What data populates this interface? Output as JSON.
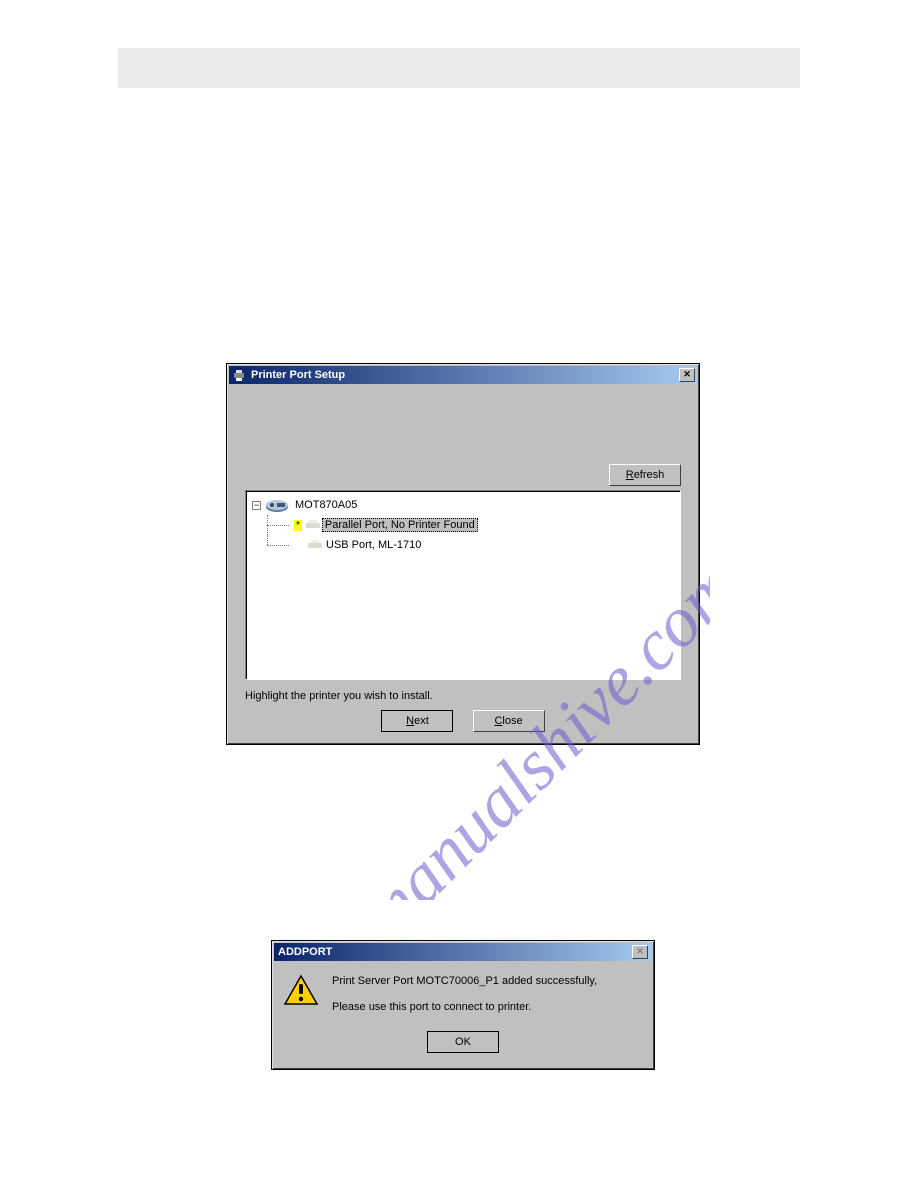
{
  "dialog1": {
    "title": "Printer Port Setup",
    "refresh_label": "Refresh",
    "hint": "Highlight the printer you wish to install.",
    "next_label": "Next",
    "close_label": "Close",
    "tree": {
      "root": "MOT870A05",
      "items": [
        {
          "label": "Parallel Port, No Printer Found",
          "selected": true
        },
        {
          "label": "USB Port, ML-1710",
          "selected": false
        }
      ]
    }
  },
  "dialog2": {
    "title": "ADDPORT",
    "line1": "Print Server Port MOTC70006_P1 added successfully,",
    "line2": "Please use this port to connect to printer.",
    "ok_label": "OK"
  },
  "watermark_text": "manualshive.com"
}
